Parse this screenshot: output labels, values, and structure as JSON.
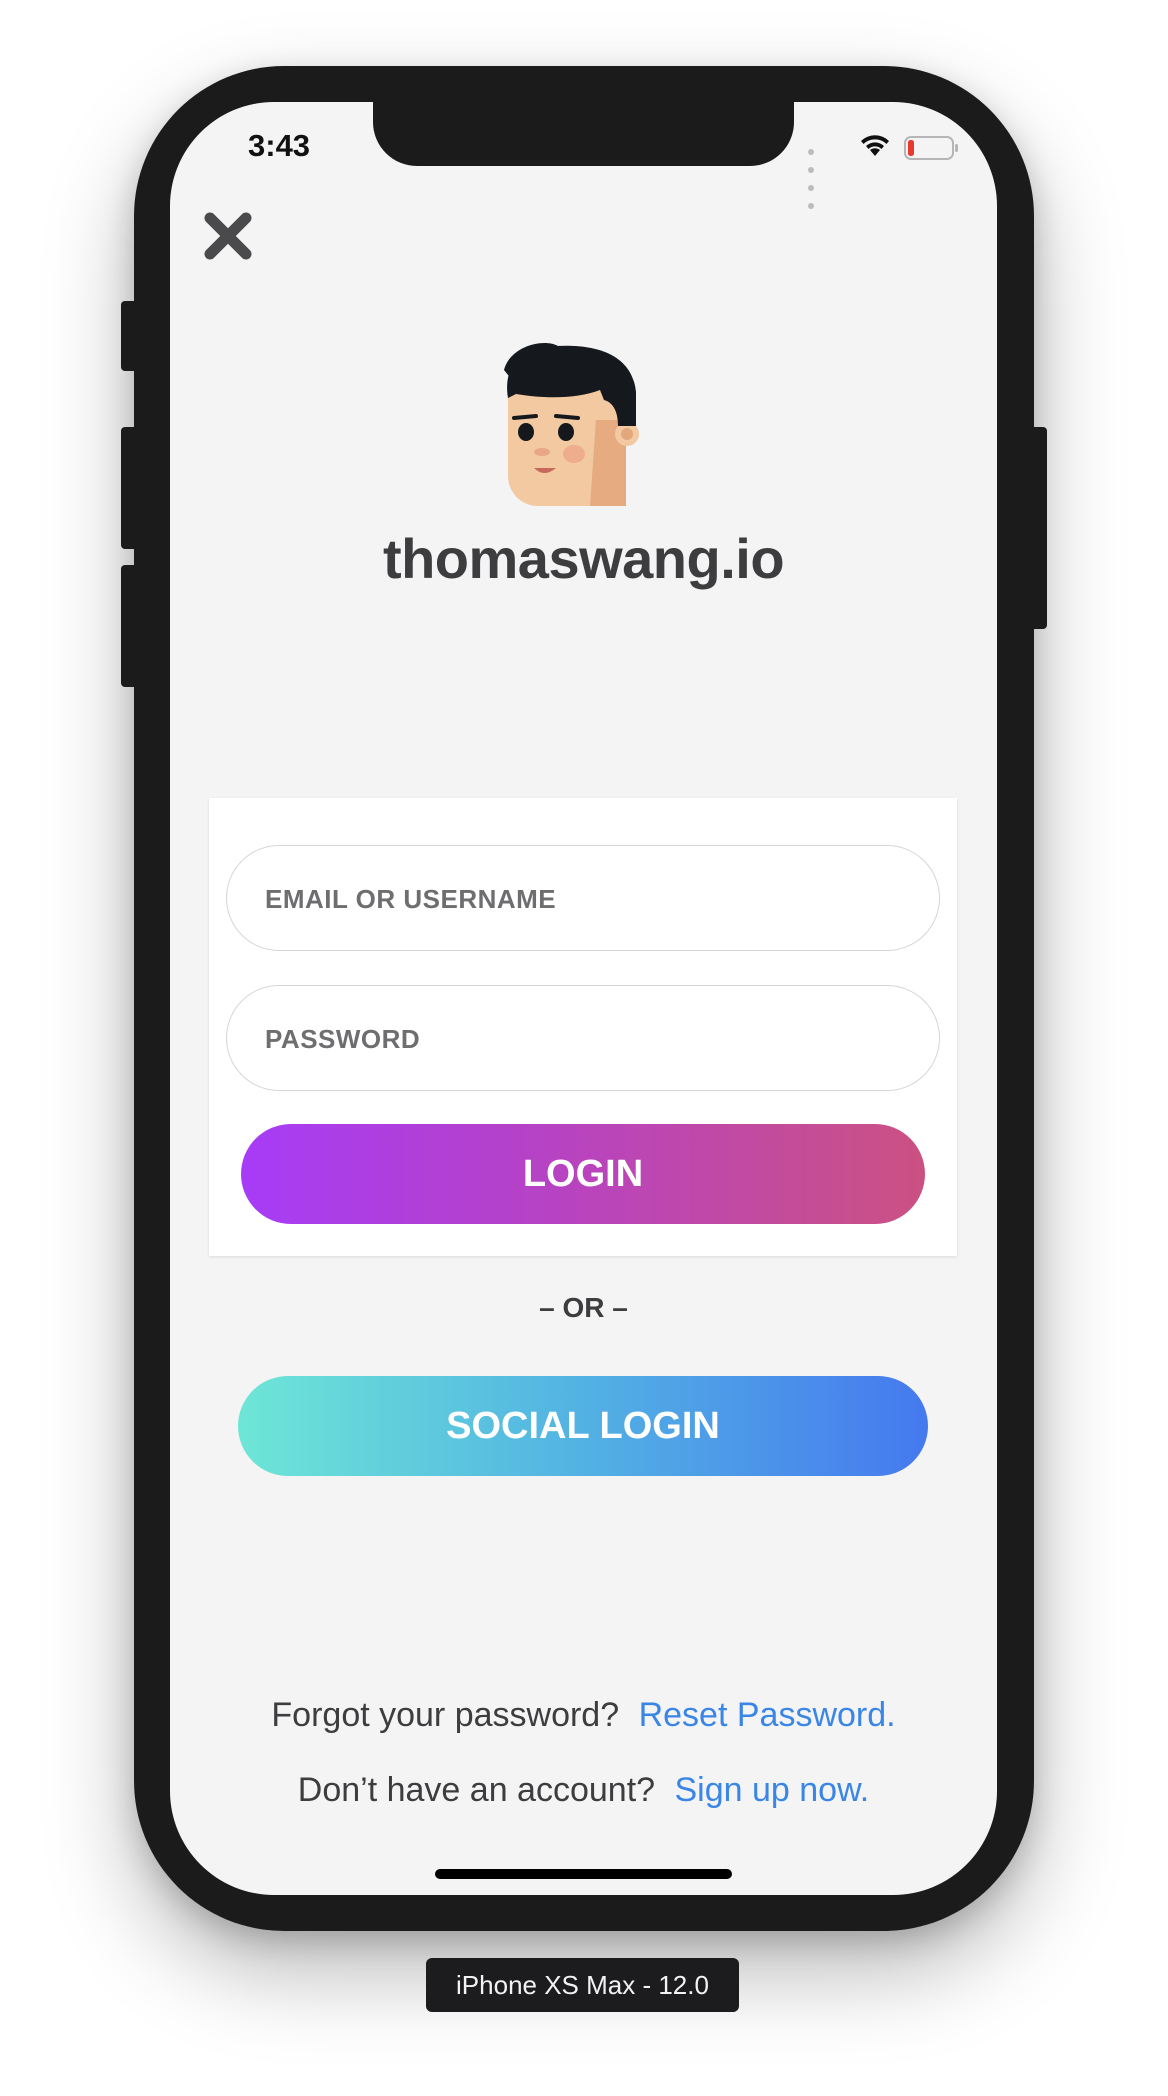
{
  "status_bar": {
    "time": "3:43",
    "signal_icon": "signal-dots-icon",
    "wifi_icon": "wifi-icon",
    "battery_icon": "battery-low-icon"
  },
  "header": {
    "close_icon": "close-icon",
    "avatar": "cartoon-face-avatar",
    "brand_name": "thomaswang.io"
  },
  "login_form": {
    "email_placeholder": "EMAIL OR USERNAME",
    "password_placeholder": "PASSWORD",
    "login_label": "LOGIN"
  },
  "separator": "– OR –",
  "social_login_label": "SOCIAL LOGIN",
  "footer": {
    "forgot_text": "Forgot your password?",
    "reset_link": "Reset Password.",
    "signup_text": "Don’t have an account?",
    "signup_link": "Sign up now."
  },
  "device_label": "iPhone XS Max - 12.0",
  "colors": {
    "screen_bg": "#f4f4f5",
    "login_gradient_start": "#a73cf7",
    "login_gradient_end": "#cb5182",
    "social_gradient_start": "#6ee6d6",
    "social_gradient_end": "#4579ef",
    "link": "#3a86e6",
    "text": "#3d3d3f"
  }
}
